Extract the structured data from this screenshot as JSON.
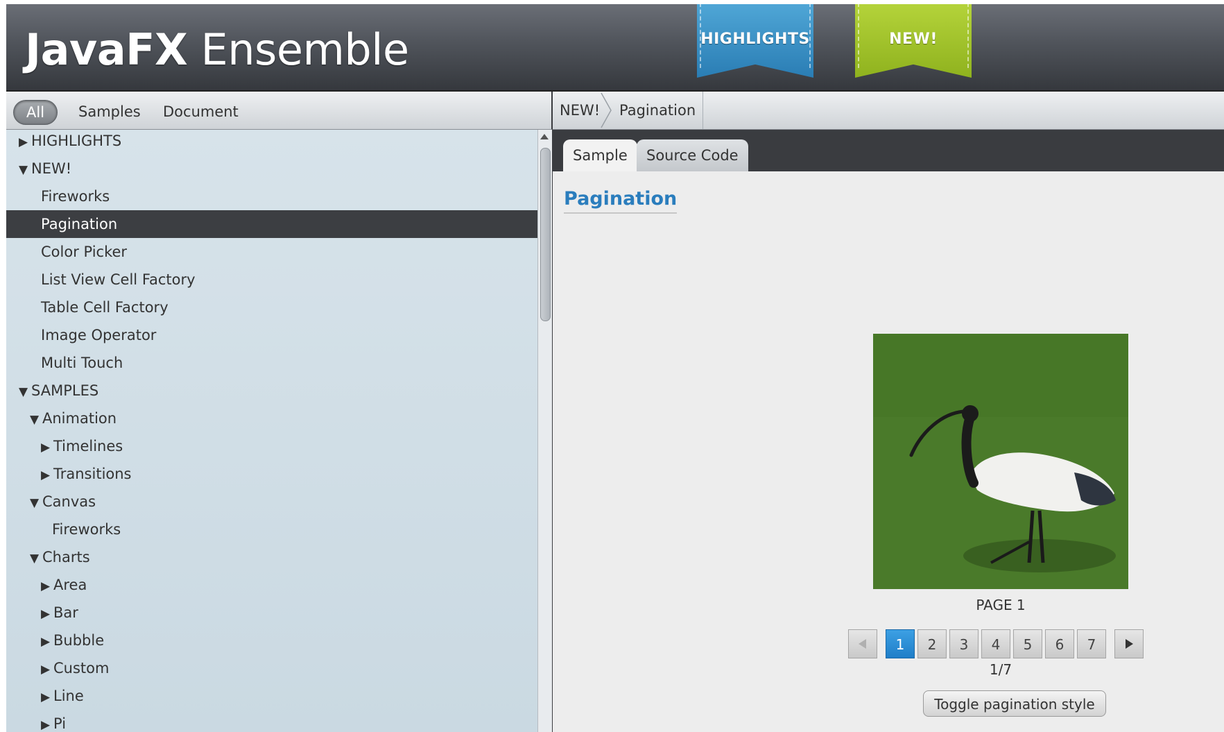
{
  "header": {
    "title_bold": "JavaFX",
    "title_light": "Ensemble",
    "ribbons": {
      "highlights": "HIGHLIGHTS",
      "new": "NEW!"
    },
    "colors": {
      "highlights": "#2a7db4",
      "new": "#8fb21e",
      "selection": "#3c3e42",
      "accent": "#2a7dbd"
    }
  },
  "filters": {
    "all": "All",
    "samples": "Samples",
    "document": "Document",
    "selected": "All"
  },
  "tree": {
    "items": [
      {
        "label": "HIGHLIGHTS",
        "arrow": "▶"
      },
      {
        "label": "NEW!",
        "arrow": "▼"
      },
      {
        "label": "Fireworks",
        "arrow": ""
      },
      {
        "label": "Pagination",
        "arrow": "",
        "selected": true
      },
      {
        "label": "Color Picker",
        "arrow": ""
      },
      {
        "label": "List View Cell Factory",
        "arrow": ""
      },
      {
        "label": "Table Cell Factory",
        "arrow": ""
      },
      {
        "label": "Image Operator",
        "arrow": ""
      },
      {
        "label": "Multi Touch",
        "arrow": ""
      },
      {
        "label": "SAMPLES",
        "arrow": "▼"
      },
      {
        "label": "Animation",
        "arrow": "▼"
      },
      {
        "label": "Timelines",
        "arrow": "▶"
      },
      {
        "label": "Transitions",
        "arrow": "▶"
      },
      {
        "label": "Canvas",
        "arrow": "▼"
      },
      {
        "label": "Fireworks",
        "arrow": ""
      },
      {
        "label": "Charts",
        "arrow": "▼"
      },
      {
        "label": "Area",
        "arrow": "▶"
      },
      {
        "label": "Bar",
        "arrow": "▶"
      },
      {
        "label": "Bubble",
        "arrow": "▶"
      },
      {
        "label": "Custom",
        "arrow": "▶"
      },
      {
        "label": "Line",
        "arrow": "▶"
      },
      {
        "label": "Pi",
        "arrow": "▶"
      }
    ]
  },
  "breadcrumb": {
    "first": "NEW!",
    "second": "Pagination"
  },
  "tabs": {
    "sample": "Sample",
    "source": "Source Code",
    "active": "Sample"
  },
  "sample": {
    "title": "Pagination",
    "page_label": "PAGE 1",
    "pages": [
      "1",
      "2",
      "3",
      "4",
      "5",
      "6",
      "7"
    ],
    "current_page": "1",
    "page_count": "1/7",
    "toggle_label": "Toggle pagination style"
  }
}
